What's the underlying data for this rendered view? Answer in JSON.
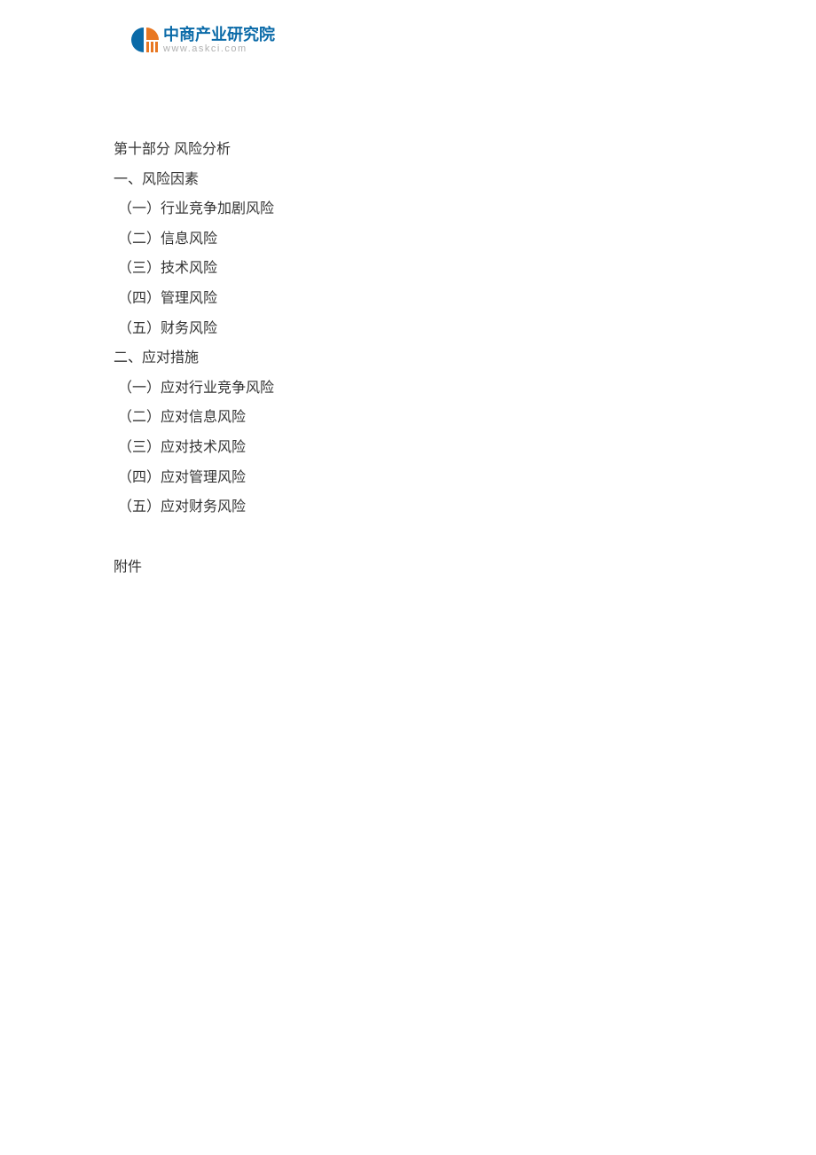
{
  "logo": {
    "cn": "中商产业研究院",
    "en": "www.askci.com"
  },
  "section_title": "第十部分 风险分析",
  "group1": {
    "heading": "一、风险因素",
    "items": [
      "（一）行业竞争加剧风险",
      "（二）信息风险",
      "（三）技术风险",
      "（四）管理风险",
      "（五）财务风险"
    ]
  },
  "group2": {
    "heading": "二、应对措施",
    "items": [
      "（一）应对行业竞争风险",
      "（二）应对信息风险",
      "（三）应对技术风险",
      "（四）应对管理风险",
      "（五）应对财务风险"
    ]
  },
  "appendix": "附件"
}
